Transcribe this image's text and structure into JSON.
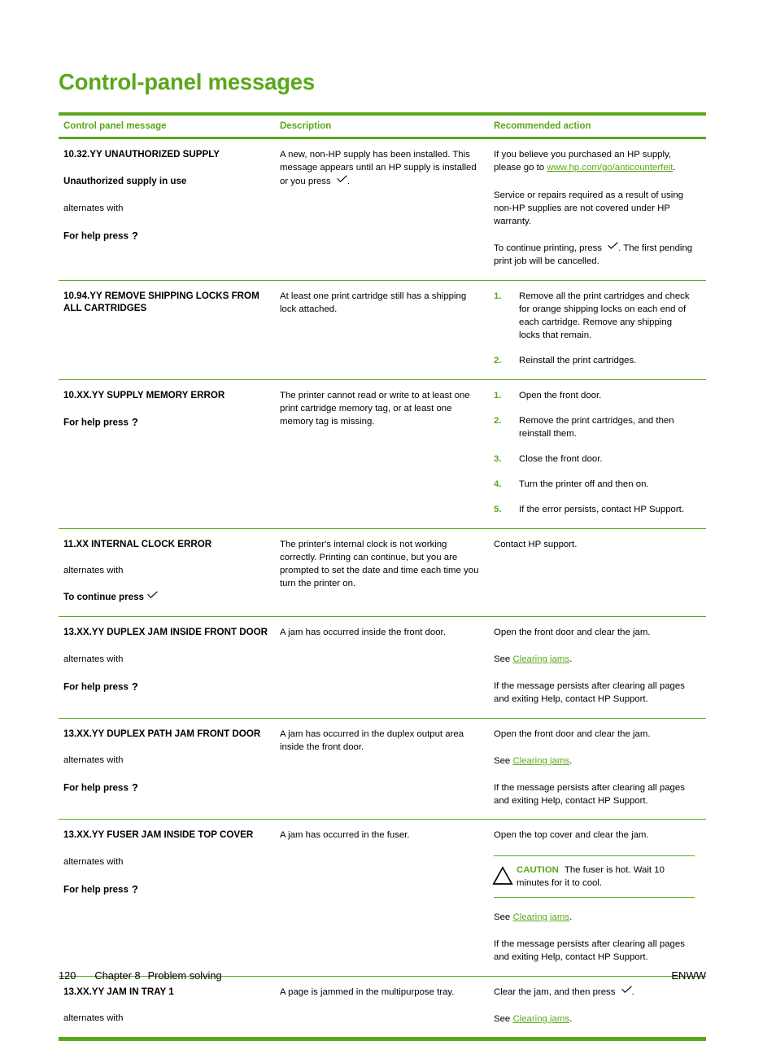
{
  "document": {
    "title": "Control-panel messages"
  },
  "table": {
    "headers": {
      "message": "Control panel message",
      "description": "Description",
      "action": "Recommended action"
    },
    "rows": [
      {
        "code": "10.32.YY UNAUTHORIZED SUPPLY",
        "sub": "Unauthorized supply in use",
        "alternates": "alternates with",
        "help": "For help press",
        "help_glyph": "question-mark-glyph",
        "description": [
          "A new, non-HP supply has been installed. This message appears until an HP supply is installed or you press "
        ],
        "description_glyph": "checkmark-glyph",
        "description_tail": ".",
        "action_paragraphs": [
          {
            "pre": "If you believe you purchased an HP supply, please go to ",
            "link": "www.hp.com/go/anticounterfeit",
            "post": "."
          },
          {
            "pre": "Service or repairs required as a result of using non-HP supplies are not covered under HP warranty."
          },
          {
            "pre": "To continue printing, press ",
            "glyph": "checkmark-glyph",
            "post": ". The first pending print job will be cancelled."
          }
        ]
      },
      {
        "code": "10.94.YY REMOVE SHIPPING LOCKS FROM ALL CARTRIDGES",
        "description": [
          "At least one print cartridge still has a shipping lock attached."
        ],
        "action_steps": [
          "Remove all the print cartridges and check for orange shipping locks on each end of each cartridge. Remove any shipping locks that remain.",
          "Reinstall the print cartridges."
        ]
      },
      {
        "code": "10.XX.YY SUPPLY MEMORY ERROR",
        "help": "For help press",
        "help_glyph": "question-mark-glyph",
        "description": [
          "The printer cannot read or write to at least one print cartridge memory tag, or at least one memory tag is missing."
        ],
        "action_steps": [
          "Open the front door.",
          "Remove the print cartridges, and then reinstall them.",
          "Close the front door.",
          "Turn the printer off and then on.",
          "If the error persists, contact HP Support."
        ]
      },
      {
        "code": "11.XX INTERNAL CLOCK ERROR",
        "alternates": "alternates with",
        "continue": "To continue press",
        "continue_glyph": "checkmark-glyph",
        "description": [
          "The printer's internal clock is not working correctly. Printing can continue, but you are prompted to set the date and time each time you turn the printer on."
        ],
        "action_paragraphs": [
          {
            "pre": "Contact HP support."
          }
        ]
      },
      {
        "code": "13.XX.YY DUPLEX JAM INSIDE FRONT DOOR",
        "alternates": "alternates with",
        "help": "For help press",
        "help_glyph": "question-mark-glyph",
        "description": [
          "A jam has occurred inside the front door."
        ],
        "action_paragraphs": [
          {
            "pre": "Open the front door and clear the jam."
          },
          {
            "pre": "See ",
            "link": "Clearing jams",
            "post": "."
          },
          {
            "pre": "If the message persists after clearing all pages and exiting Help, contact HP Support."
          }
        ]
      },
      {
        "code": "13.XX.YY DUPLEX PATH JAM FRONT DOOR",
        "alternates": "alternates with",
        "help": "For help press",
        "help_glyph": "question-mark-glyph",
        "description": [
          "A jam has occurred in the duplex output area inside the front door."
        ],
        "action_paragraphs": [
          {
            "pre": "Open the front door and clear the jam."
          },
          {
            "pre": "See ",
            "link": "Clearing jams",
            "post": "."
          },
          {
            "pre": "If the message persists after clearing all pages and exiting Help, contact HP Support."
          }
        ]
      },
      {
        "code": "13.XX.YY FUSER JAM INSIDE TOP COVER",
        "alternates": "alternates with",
        "help": "For help press",
        "help_glyph": "question-mark-glyph",
        "description": [
          "A jam has occurred in the fuser."
        ],
        "action_first": "Open the top cover and clear the jam.",
        "caution": {
          "icon": "warning-triangle-icon",
          "label": "CAUTION",
          "text": "The fuser is hot. Wait 10 minutes for it to cool."
        },
        "action_paragraphs": [
          {
            "pre": "See ",
            "link": "Clearing jams",
            "post": "."
          },
          {
            "pre": "If the message persists after clearing all pages and exiting Help, contact HP Support."
          }
        ]
      },
      {
        "code": "13.XX.YY JAM IN TRAY 1",
        "alternates": "alternates with",
        "description": [
          "A page is jammed in the multipurpose tray."
        ],
        "action_paragraphs": [
          {
            "pre": "Clear the jam, and then press ",
            "glyph": "checkmark-glyph",
            "post": "."
          },
          {
            "pre": "See ",
            "link": "Clearing jams",
            "post": "."
          }
        ]
      }
    ]
  },
  "footer": {
    "page_number": "120",
    "chapter": "Chapter 8",
    "chapter_title": "Problem solving",
    "locale": "ENWW"
  },
  "colors": {
    "accent_green": "#5aa81a",
    "text": "#000000"
  }
}
